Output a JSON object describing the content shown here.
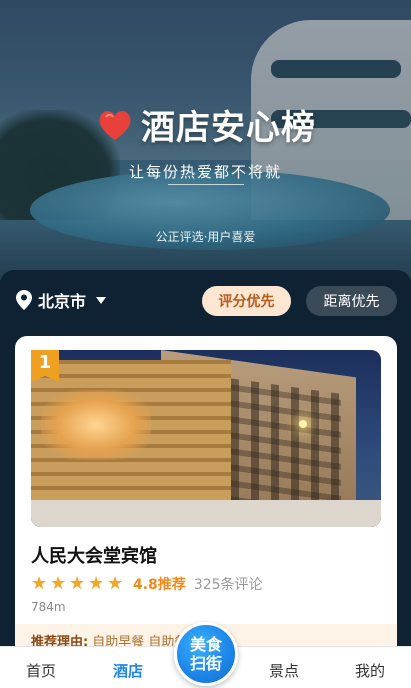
{
  "hero": {
    "title": "酒店安心榜",
    "subtitle": "让每份热爱都不将就",
    "tagline": "公正评选·用户喜爱"
  },
  "filter": {
    "city": "北京市",
    "sort_options": [
      "评分优先",
      "距离优先"
    ],
    "active_sort": "评分优先"
  },
  "hotel": {
    "rank": "1",
    "name": "人民大会堂宾馆",
    "stars": 5,
    "score": "4.8推荐",
    "reviews": "325条评论",
    "distance": "784m",
    "reason_label": "推荐理由:",
    "reason_text": "自助早餐 自助餐厅 酒店"
  },
  "bottom_nav": {
    "home": "首页",
    "hotel": "酒店",
    "food_line1": "美食",
    "food_line2": "扫街",
    "spots": "景点",
    "mine": "我的"
  },
  "colors": {
    "accent_blue": "#1e88e5",
    "score_orange": "#f08a1c",
    "heart_red": "#e8403a"
  }
}
